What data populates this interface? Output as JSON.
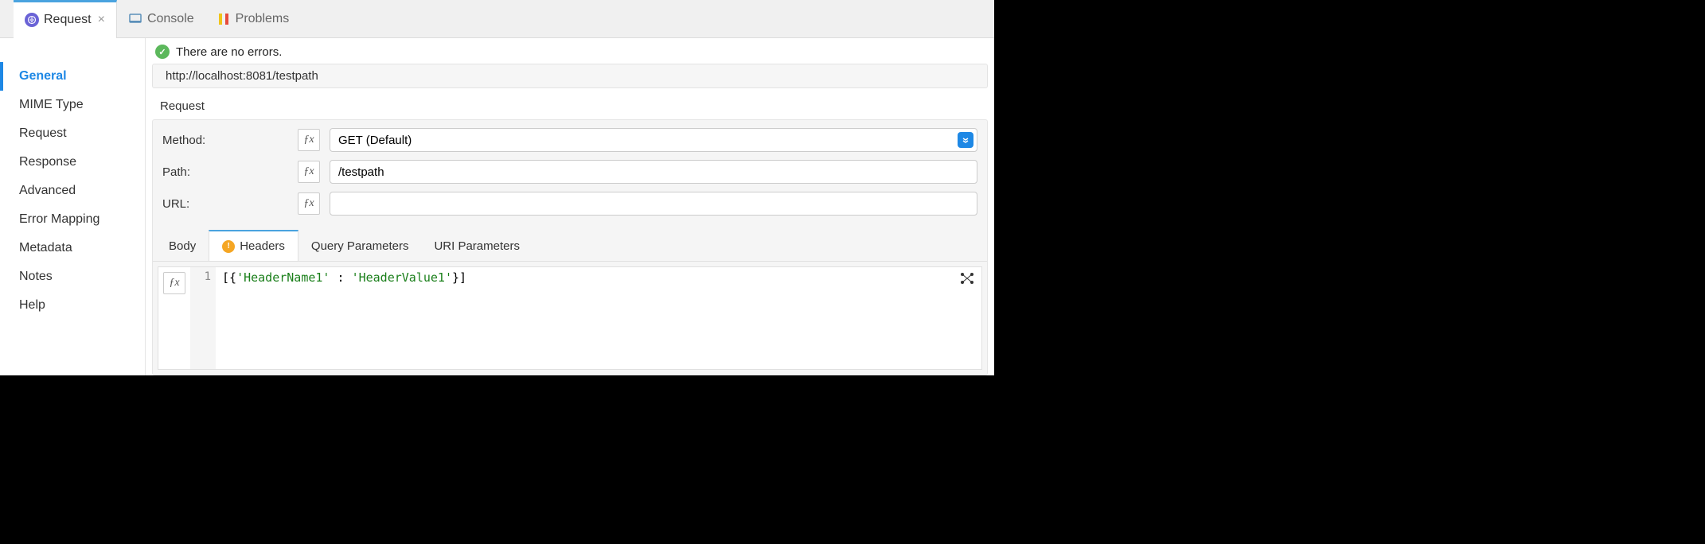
{
  "top_tabs": {
    "request": "Request",
    "console": "Console",
    "problems": "Problems"
  },
  "sidebar": {
    "items": [
      {
        "label": "General",
        "active": true
      },
      {
        "label": "MIME Type"
      },
      {
        "label": "Request"
      },
      {
        "label": "Response"
      },
      {
        "label": "Advanced"
      },
      {
        "label": "Error Mapping"
      },
      {
        "label": "Metadata"
      },
      {
        "label": "Notes"
      },
      {
        "label": "Help"
      }
    ]
  },
  "status": {
    "text": "There are no errors."
  },
  "url_bar": "http://localhost:8081/testpath",
  "section": {
    "label": "Request"
  },
  "form": {
    "method_label": "Method:",
    "method_value": "GET (Default)",
    "path_label": "Path:",
    "path_value": "/testpath",
    "url_label": "URL:",
    "url_value": ""
  },
  "inner_tabs": {
    "body": "Body",
    "headers": "Headers",
    "query": "Query Parameters",
    "uri": "URI Parameters"
  },
  "code": {
    "line_no": "1",
    "prefix": "[{",
    "key": "'HeaderName1'",
    "sep": " : ",
    "val": "'HeaderValue1'",
    "suffix": "}]"
  },
  "fx": "ƒx"
}
